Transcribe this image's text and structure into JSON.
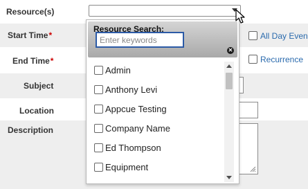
{
  "form": {
    "fields": {
      "resources": "Resource(s)",
      "start_time": "Start Time",
      "end_time": "End Time",
      "subject": "Subject",
      "location": "Location",
      "description": "Description"
    },
    "required_marker": "*",
    "all_day_event": "All Day Even",
    "recurrence": "Recurrence"
  },
  "resource_dropdown": {
    "title": "Resource Search:",
    "search_placeholder": "Enter keywords",
    "search_value": "",
    "items": [
      {
        "label": "Admin",
        "checked": false
      },
      {
        "label": "Anthony Levi",
        "checked": false
      },
      {
        "label": "Appcue Testing",
        "checked": false
      },
      {
        "label": "Company Name",
        "checked": false
      },
      {
        "label": "Ed Thompson",
        "checked": false
      },
      {
        "label": "Equipment",
        "checked": false
      }
    ]
  },
  "colors": {
    "row_shade": "#eeeeee",
    "required": "#cc0000",
    "link": "#2a6aad",
    "search_focus": "#2b5aa6"
  },
  "icons": {
    "dropdown_arrow": "chevron-down-icon",
    "cursor": "mouse-pointer-icon",
    "clear": "clear-search-icon",
    "resize": "resize-grip-icon"
  }
}
